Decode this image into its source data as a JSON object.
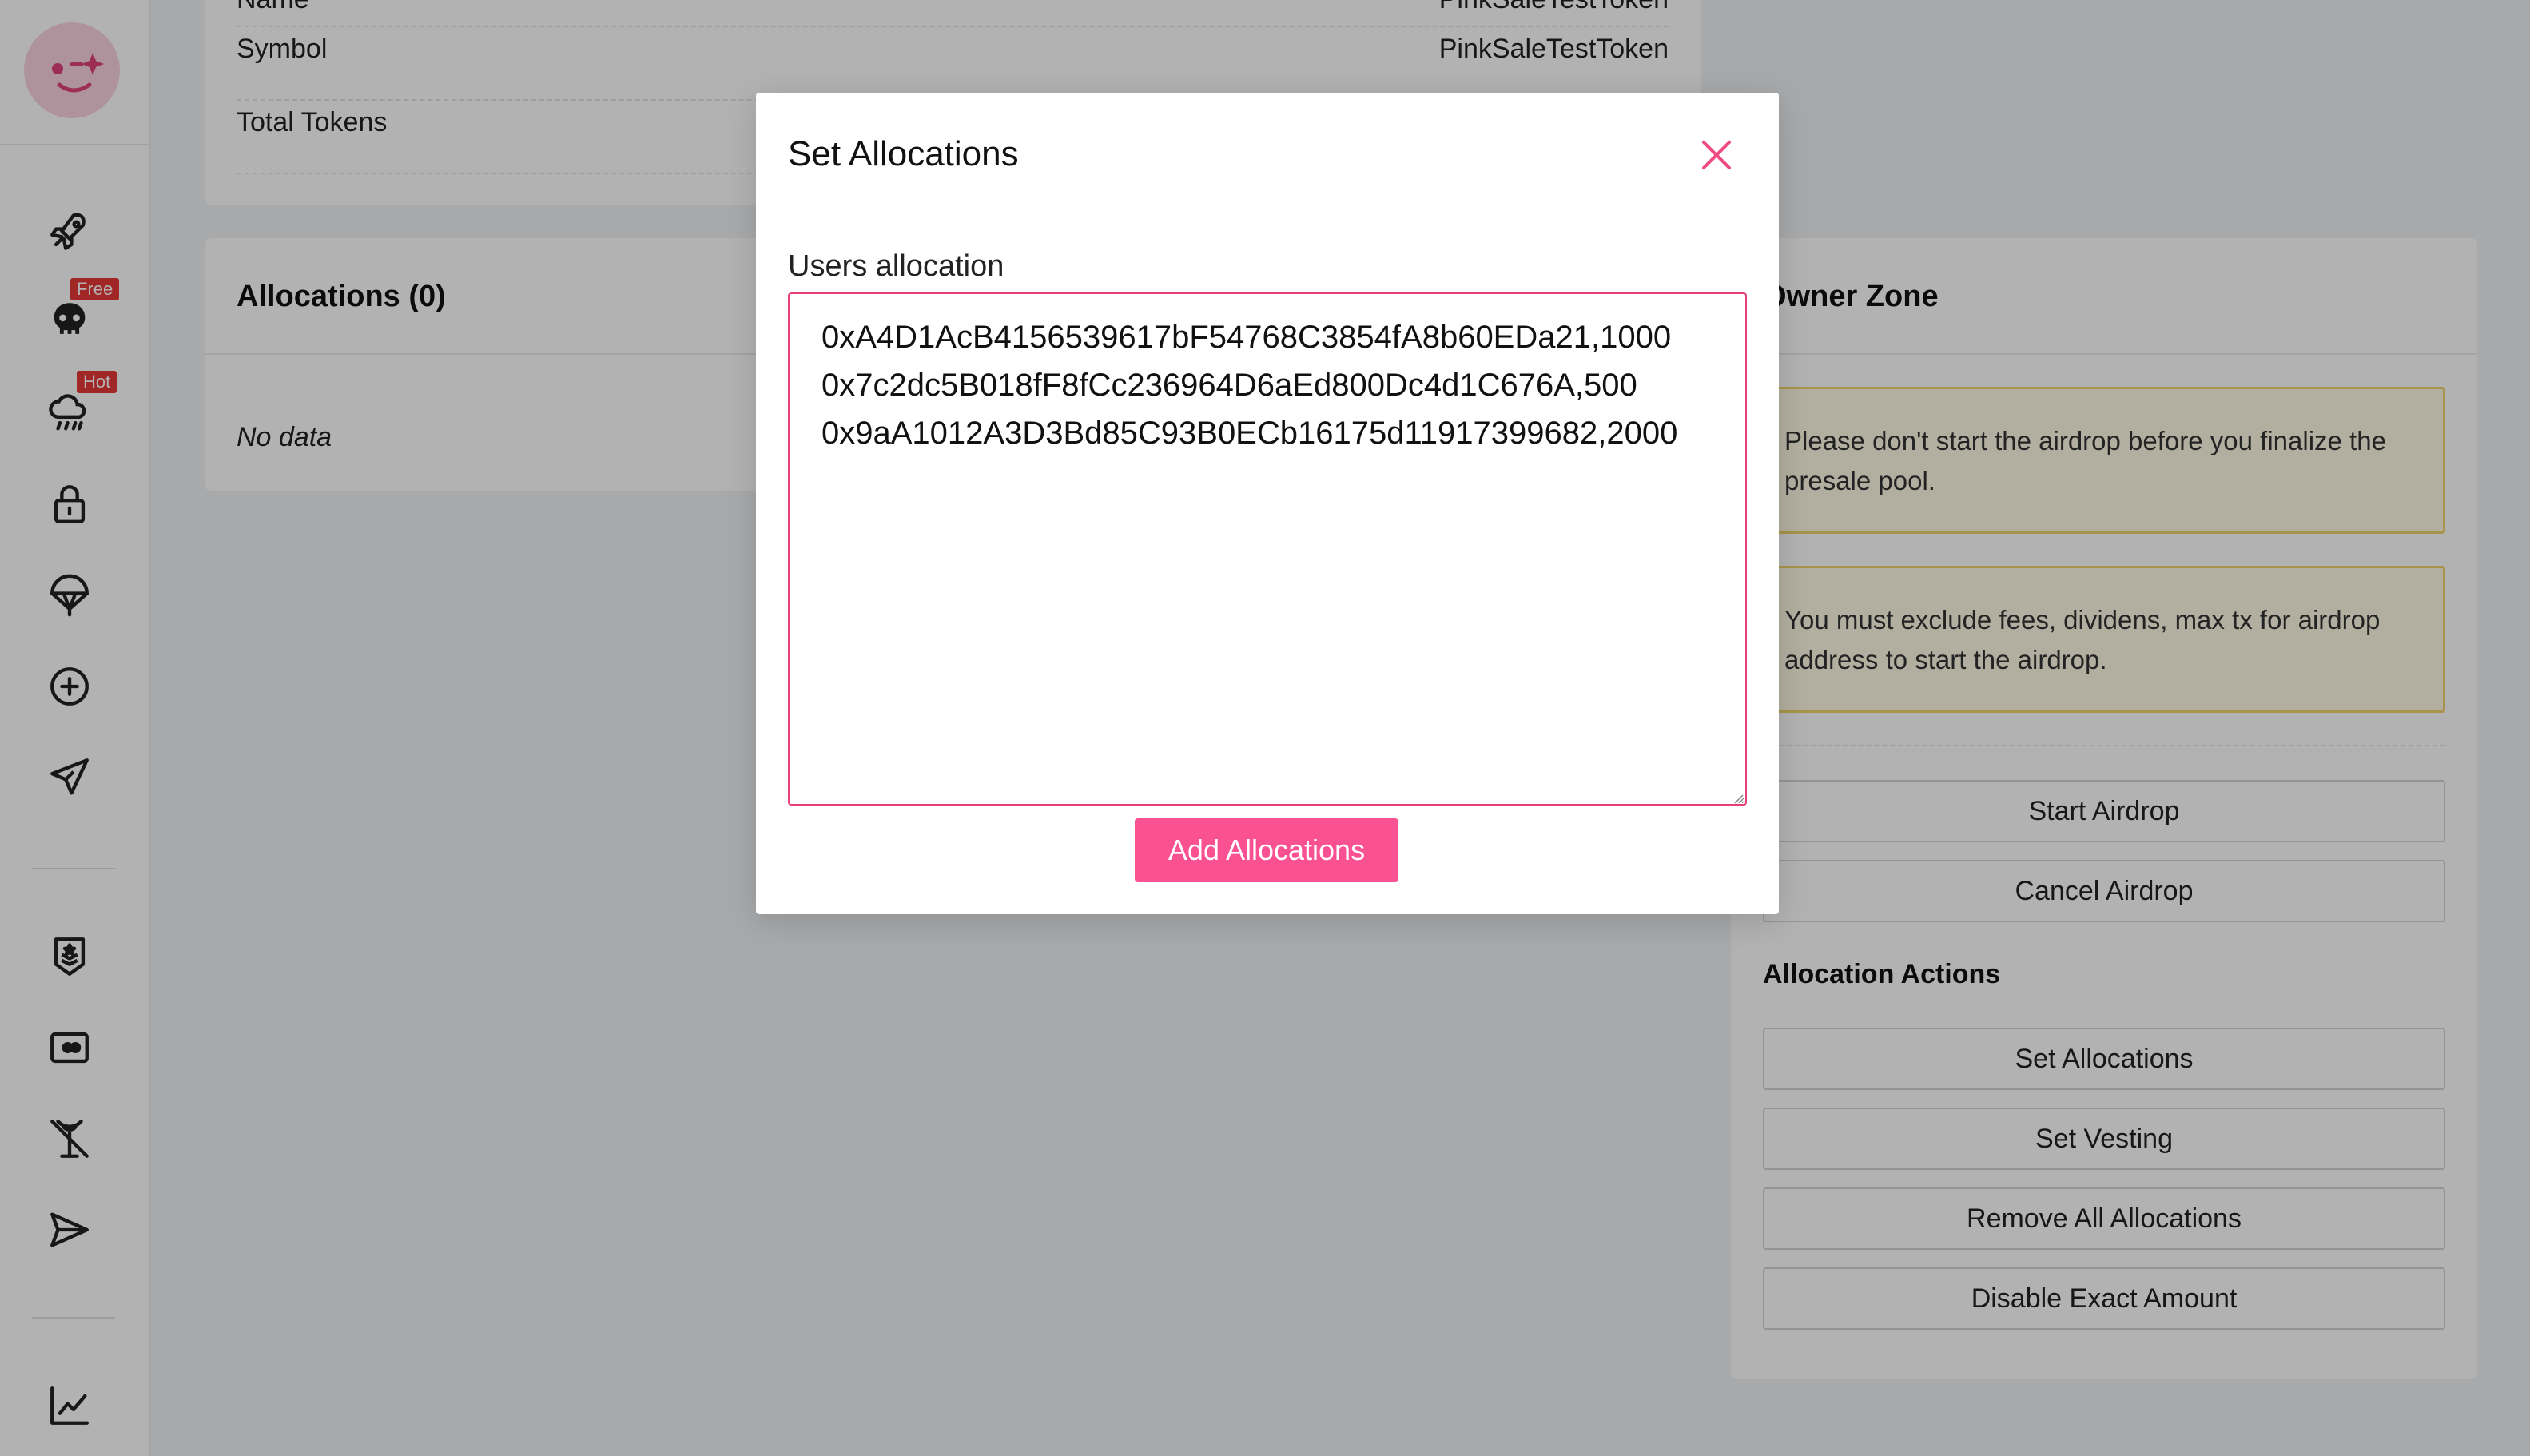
{
  "token_info": {
    "name_label": "Name",
    "name_value": "PinkSaleTestToken",
    "symbol_label": "Symbol",
    "symbol_value": "PinkSaleTestToken",
    "total_label": "Total Tokens"
  },
  "allocations": {
    "title": "Allocations (0)",
    "empty_text": "No data"
  },
  "owner_zone": {
    "title": "Owner Zone",
    "warnings": [
      "Please don't start the airdrop before you finalize the presale pool.",
      "You must exclude fees, dividens, max tx for airdrop address to start the airdrop."
    ],
    "start_airdrop": "Start Airdrop",
    "cancel_airdrop": "Cancel Airdrop",
    "actions_title": "Allocation Actions",
    "set_allocations": "Set Allocations",
    "set_vesting": "Set Vesting",
    "remove_all": "Remove All Allocations",
    "disable_exact": "Disable Exact Amount"
  },
  "sidebar": {
    "badges": {
      "free": "Free",
      "hot": "Hot"
    },
    "icons": [
      "rocket-icon",
      "skull-icon",
      "rain-cloud-icon",
      "lock-icon",
      "parachute-icon",
      "plus-circle-icon",
      "paper-plane-icon",
      "shield-badge-icon",
      "id-card-icon",
      "antenna-off-icon",
      "send-icon",
      "chart-line-icon"
    ]
  },
  "modal": {
    "title": "Set Allocations",
    "field_label": "Users allocation",
    "textarea_value": "0xA4D1AcB4156539617bF54768C3854fA8b60EDa21,1000\n0x7c2dc5B018fF8fCc236964D6aEd800Dc4d1C676A,500\n0x9aA1012A3D3Bd85C93B0ECb16175d11917399682,2000",
    "submit_label": "Add Allocations"
  },
  "colors": {
    "accent": "#f95192",
    "accent_border": "#e6407a",
    "warning_bg": "#fffbe6",
    "warning_border": "#f0d46b",
    "badge_red": "#e53935"
  }
}
